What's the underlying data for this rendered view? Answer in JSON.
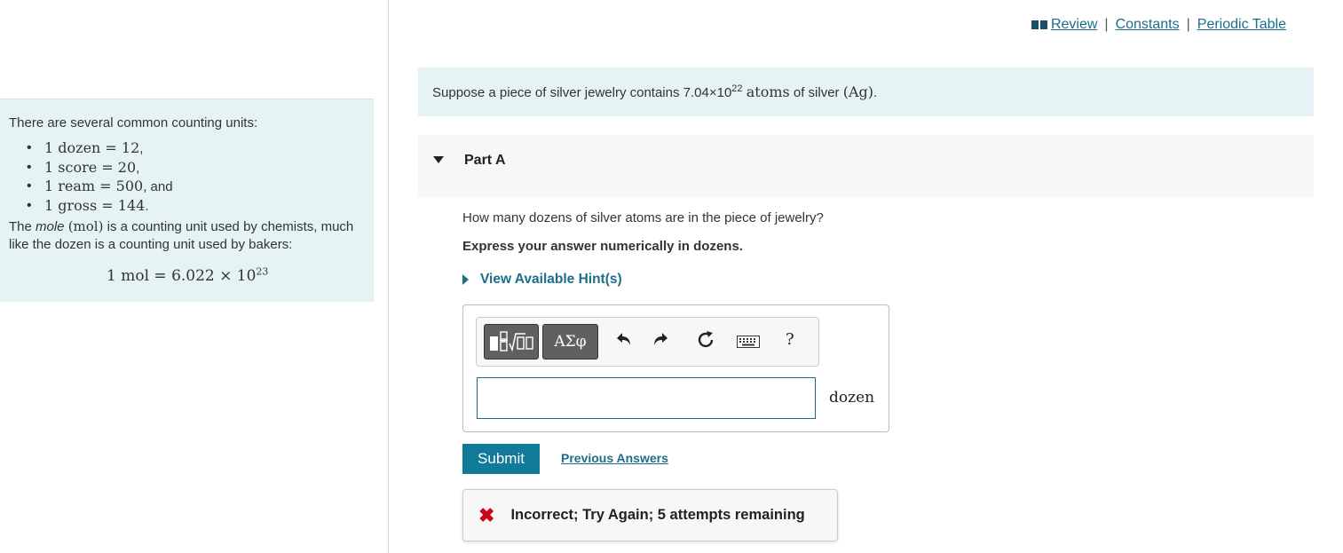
{
  "top_links": {
    "review": "Review",
    "constants": "Constants",
    "periodic_table": "Periodic Table",
    "separator": "|"
  },
  "info": {
    "intro": "There are several common counting units:",
    "units": [
      {
        "math": "1 dozen = 12",
        "suffix": ","
      },
      {
        "math": "1 score = 20",
        "suffix": ","
      },
      {
        "math": "1 ream = 500",
        "suffix": ", and"
      },
      {
        "math": "1 gross = 144",
        "suffix": "."
      }
    ],
    "mole_pre": "The ",
    "mole_word": "mole",
    "mole_symbol": "(mol)",
    "mole_post": " is a counting unit used by chemists, much like the dozen is a counting unit used by bakers:",
    "equation_base": "1 mol = 6.022 × 10",
    "equation_exp": "23"
  },
  "problem": {
    "text_pre": "Suppose a piece of silver jewelry contains 7.04×10",
    "exp": "22",
    "atoms_word": "atoms",
    "text_mid": " of silver ",
    "element": "(Ag)",
    "text_end": "."
  },
  "part": {
    "title": "Part A",
    "question": "How many dozens of silver atoms are in the piece of jewelry?",
    "instruction": "Express your answer numerically in dozens.",
    "hints_label": "View Available Hint(s)"
  },
  "toolbar": {
    "symbols_label": "ΑΣφ",
    "help_label": "?"
  },
  "answer": {
    "value": "",
    "unit": "dozen"
  },
  "actions": {
    "submit_label": "Submit",
    "previous_answers_label": "Previous Answers"
  },
  "feedback": {
    "icon": "✖",
    "text": "Incorrect; Try Again; 5 attempts remaining"
  },
  "colors": {
    "accent": "#107a98",
    "link": "#1a6d8b",
    "info_bg": "#e5f3f4",
    "error": "#d0021b"
  }
}
